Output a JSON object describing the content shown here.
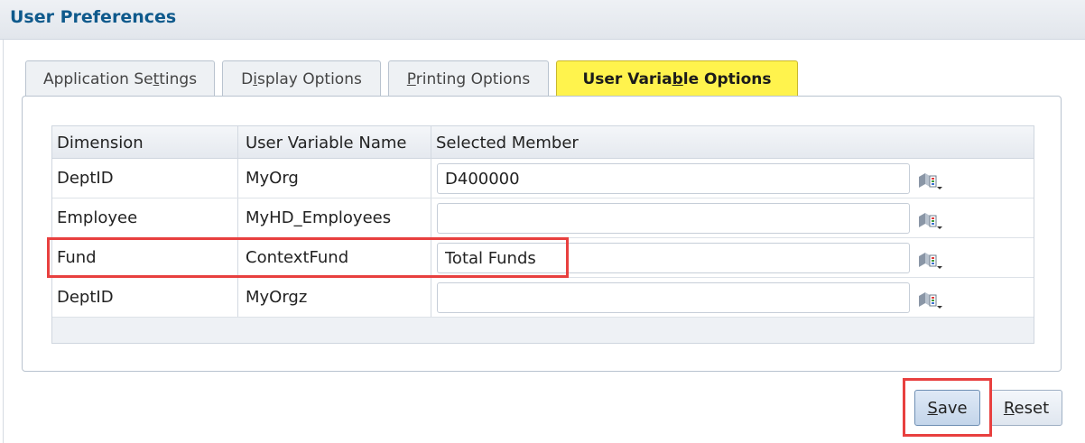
{
  "header": {
    "title": "User Preferences"
  },
  "tabs": [
    {
      "label_pre": "Application Se",
      "label_u": "t",
      "label_post": "tings",
      "active": false
    },
    {
      "label_pre": "D",
      "label_u": "i",
      "label_post": "splay Options",
      "active": false
    },
    {
      "label_pre": "",
      "label_u": "P",
      "label_post": "rinting Options",
      "active": false
    },
    {
      "label_pre": "User Varia",
      "label_u": "b",
      "label_post": "le Options",
      "active": true
    }
  ],
  "grid": {
    "columns": [
      "Dimension",
      "User Variable Name",
      "Selected Member"
    ],
    "rows": [
      {
        "dimension": "DeptID",
        "variable": "MyOrg",
        "member": "D400000"
      },
      {
        "dimension": "Employee",
        "variable": "MyHD_Employees",
        "member": ""
      },
      {
        "dimension": "Fund",
        "variable": "ContextFund",
        "member": "Total Funds"
      },
      {
        "dimension": "DeptID",
        "variable": "MyOrgz",
        "member": ""
      }
    ]
  },
  "buttons": {
    "save_u": "S",
    "save_rest": "ave",
    "reset_u": "R",
    "reset_rest": "eset"
  },
  "icons": {
    "member_picker": "member-selector-icon"
  },
  "colors": {
    "accent": "#0f5a8c",
    "active_tab": "#fff34d",
    "highlight": "#e8403f"
  }
}
